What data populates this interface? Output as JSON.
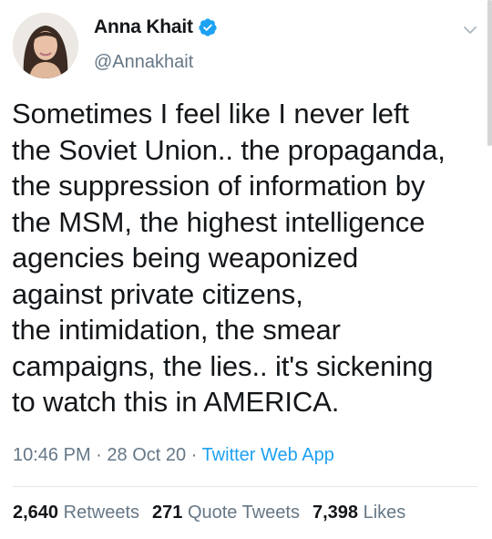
{
  "author": {
    "display_name": "Anna Khait",
    "handle": "@Annakhait",
    "verified": true
  },
  "tweet": {
    "lines": [
      "Sometimes I feel like I never left",
      "the Soviet Union.. the propaganda,",
      "the suppression of information by",
      "the MSM, the highest intelligence",
      "agencies being weaponized",
      "against private citizens,",
      "the intimidation, the smear",
      "campaigns, the lies.. it's sickening",
      "to watch this in AMERICA."
    ],
    "time": "10:46 PM",
    "separator": "·",
    "date": "28 Oct 20",
    "source": "Twitter Web App"
  },
  "stats": {
    "retweets_count": "2,640",
    "retweets_label": "Retweets",
    "quote_count": "271",
    "quote_label": "Quote Tweets",
    "likes_count": "7,398",
    "likes_label": "Likes"
  },
  "colors": {
    "text": "#14171a",
    "secondary": "#657786",
    "accent": "#1da1f2",
    "divider": "#e1e8ed"
  },
  "icons": {
    "verified": "verified-badge-icon",
    "caret": "chevron-down-icon"
  }
}
